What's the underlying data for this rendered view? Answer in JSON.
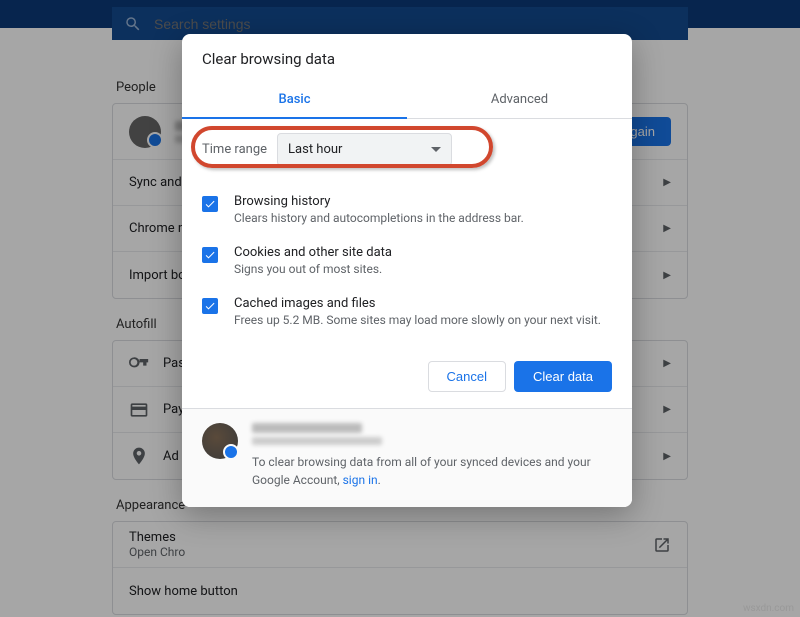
{
  "search": {
    "placeholder": "Search settings"
  },
  "sections": {
    "people": "People",
    "autofill": "Autofill",
    "appearance": "Appearance"
  },
  "peopleCard": {
    "signin_btn": "n in again",
    "sync": "Sync and",
    "chrome_name": "Chrome na",
    "import_bookmarks": "Import boo"
  },
  "autofillCard": {
    "passwords": "Pas",
    "payments": "Pay",
    "addresses": "Ad"
  },
  "appearanceCard": {
    "themes": "Themes",
    "themes_sub": "Open Chro",
    "show_home": "Show home button"
  },
  "dialog": {
    "title": "Clear browsing data",
    "tabs": {
      "basic": "Basic",
      "advanced": "Advanced"
    },
    "time_label": "Time range",
    "time_value": "Last hour",
    "items": [
      {
        "title": "Browsing history",
        "sub": "Clears history and autocompletions in the address bar."
      },
      {
        "title": "Cookies and other site data",
        "sub": "Signs you out of most sites."
      },
      {
        "title": "Cached images and files",
        "sub": "Frees up 5.2 MB. Some sites may load more slowly on your next visit."
      }
    ],
    "cancel": "Cancel",
    "clear": "Clear data",
    "footer_text": "To clear browsing data from all of your synced devices and your Google Account, ",
    "footer_link": "sign in"
  },
  "watermark": "wsxdn.com"
}
